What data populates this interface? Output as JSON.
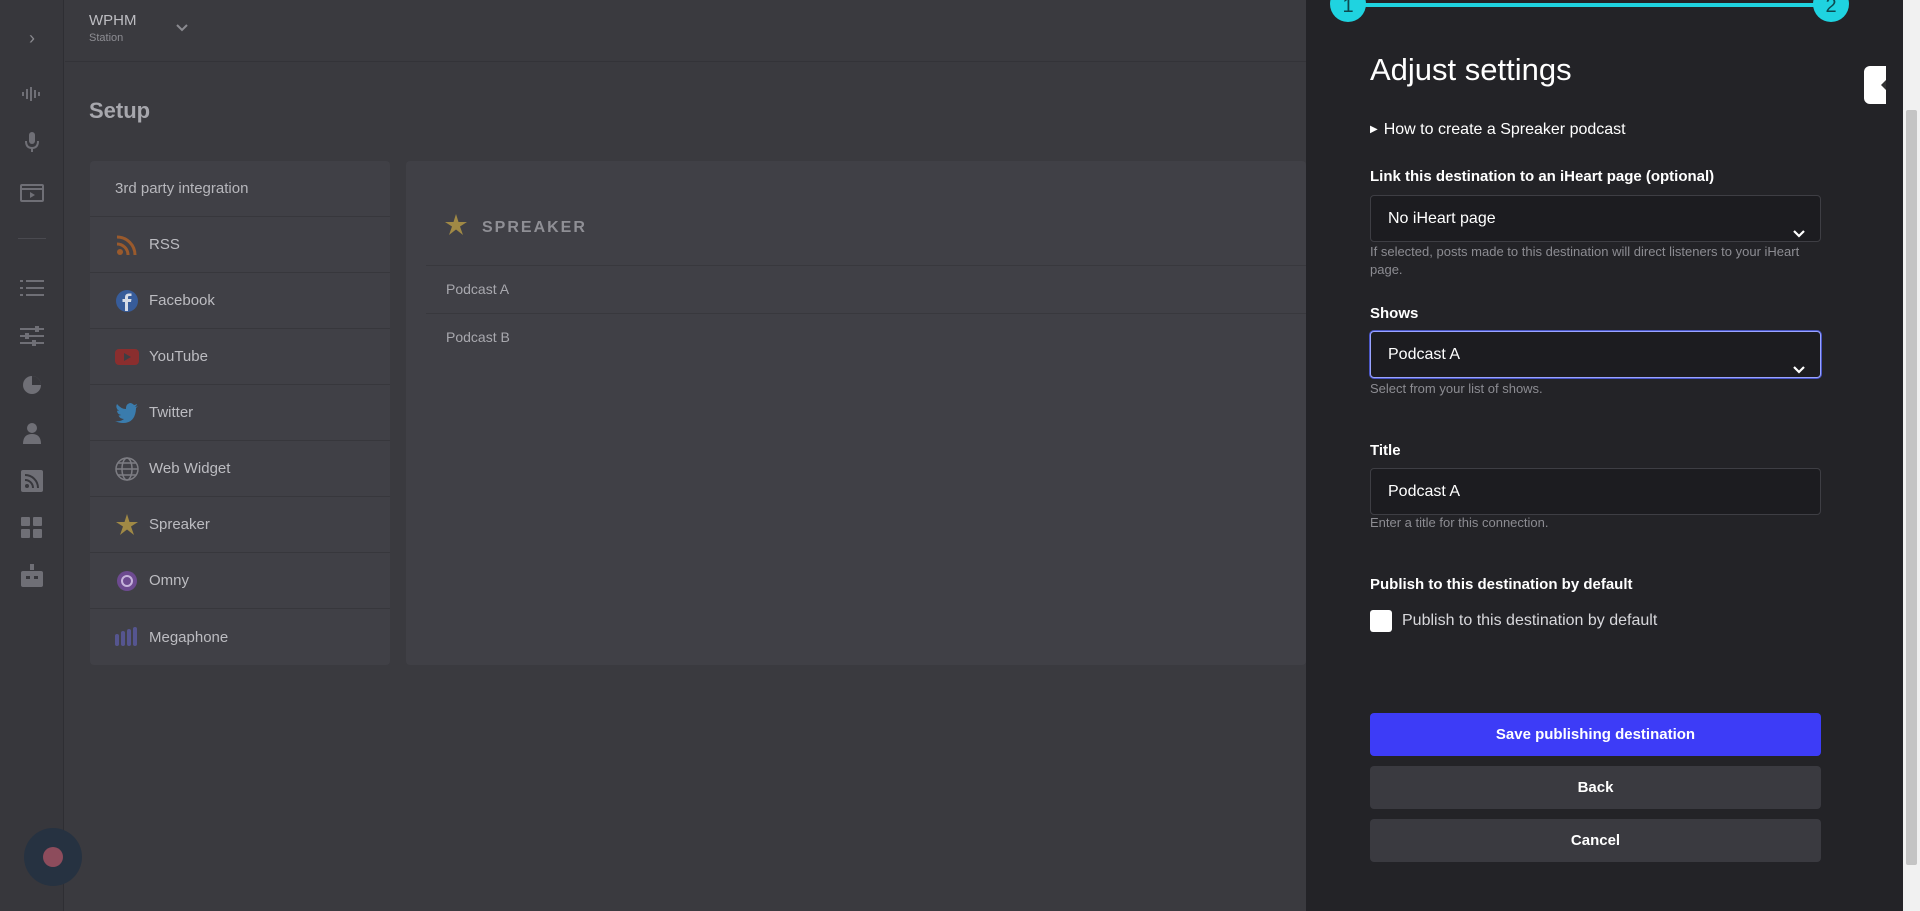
{
  "station": {
    "name": "WPHM",
    "type": "Station"
  },
  "page": {
    "title": "Setup"
  },
  "integrations": {
    "header": "3rd party integration",
    "items": [
      {
        "label": "RSS",
        "icon": "rss-icon"
      },
      {
        "label": "Facebook",
        "icon": "facebook-icon"
      },
      {
        "label": "YouTube",
        "icon": "youtube-icon"
      },
      {
        "label": "Twitter",
        "icon": "twitter-icon"
      },
      {
        "label": "Web Widget",
        "icon": "globe-icon"
      },
      {
        "label": "Spreaker",
        "icon": "spreaker-icon"
      },
      {
        "label": "Omny",
        "icon": "omny-icon"
      },
      {
        "label": "Megaphone",
        "icon": "megaphone-icon"
      }
    ]
  },
  "main": {
    "provider_name": "SPREAKER",
    "podcasts": [
      "Podcast A",
      "Podcast B"
    ]
  },
  "drawer": {
    "steps": [
      "1",
      "2"
    ],
    "title": "Adjust settings",
    "howto": "How to create a Spreaker podcast",
    "iheart": {
      "label": "Link this destination to an iHeart page (optional)",
      "value": "No iHeart page",
      "hint": "If selected, posts made to this destination will direct listeners to your iHeart page."
    },
    "shows": {
      "label": "Shows",
      "value": "Podcast A",
      "hint": "Select from your list of shows."
    },
    "title_field": {
      "label": "Title",
      "value": "Podcast A",
      "hint": "Enter a title for this connection."
    },
    "publish_default": {
      "label": "Publish to this destination by default",
      "checkbox_label": "Publish to this destination by default",
      "checked": false
    },
    "buttons": {
      "save": "Save publishing destination",
      "back": "Back",
      "cancel": "Cancel"
    }
  },
  "colors": {
    "accent": "#1fd3e0",
    "primary_button": "#3d3cf7",
    "drawer_bg": "#232327",
    "page_bg": "#3a3a3f"
  }
}
